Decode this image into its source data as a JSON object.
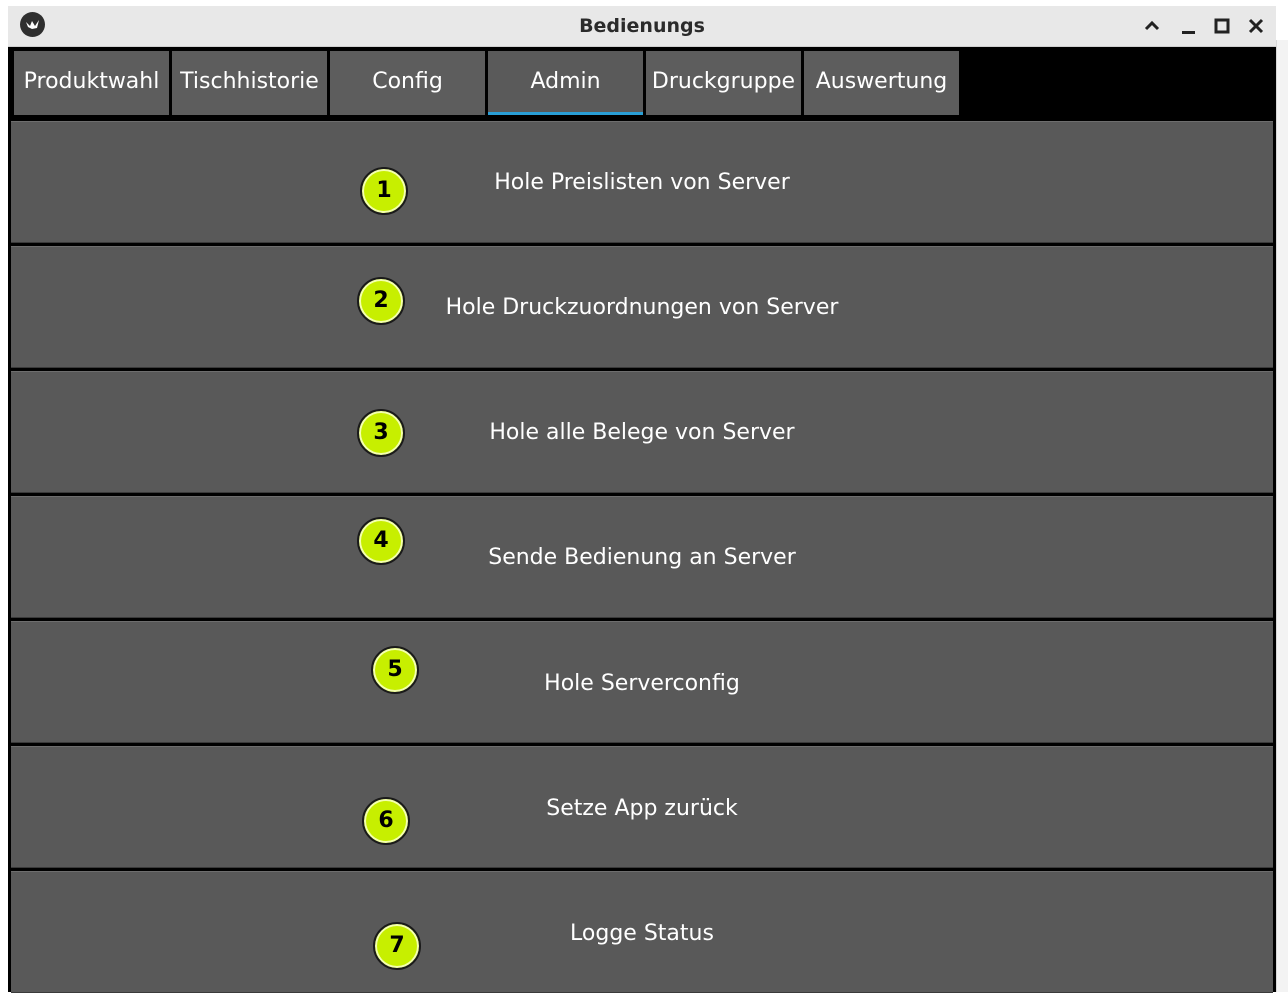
{
  "window": {
    "title": "Bedienungs",
    "app_icon": "kivy-logo-icon",
    "controls": {
      "up": "chevron-up-icon",
      "minimize": "minimize-icon",
      "maximize": "maximize-icon",
      "close": "close-icon"
    }
  },
  "tabs": [
    {
      "label": "Produktwahl",
      "active": false
    },
    {
      "label": "Tischhistorie",
      "active": false
    },
    {
      "label": "Config",
      "active": false
    },
    {
      "label": "Admin",
      "active": true
    },
    {
      "label": "Druckgruppe",
      "active": false
    },
    {
      "label": "Auswertung",
      "active": false
    }
  ],
  "admin": {
    "buttons": [
      {
        "number": "1",
        "label": "Hole Preislisten von Server"
      },
      {
        "number": "2",
        "label": "Hole Druckzuordnungen von Server"
      },
      {
        "number": "3",
        "label": "Hole alle Belege von Server"
      },
      {
        "number": "4",
        "label": "Sende Bedienung an Server"
      },
      {
        "number": "5",
        "label": "Hole Serverconfig"
      },
      {
        "number": "6",
        "label": "Setze App zurück"
      },
      {
        "number": "7",
        "label": "Logge Status"
      }
    ]
  },
  "colors": {
    "tab_bg": "#5d5d5d",
    "button_bg": "#595959",
    "active_tab_indicator": "#2a9fd6",
    "badge_fill": "#c7ef00"
  }
}
